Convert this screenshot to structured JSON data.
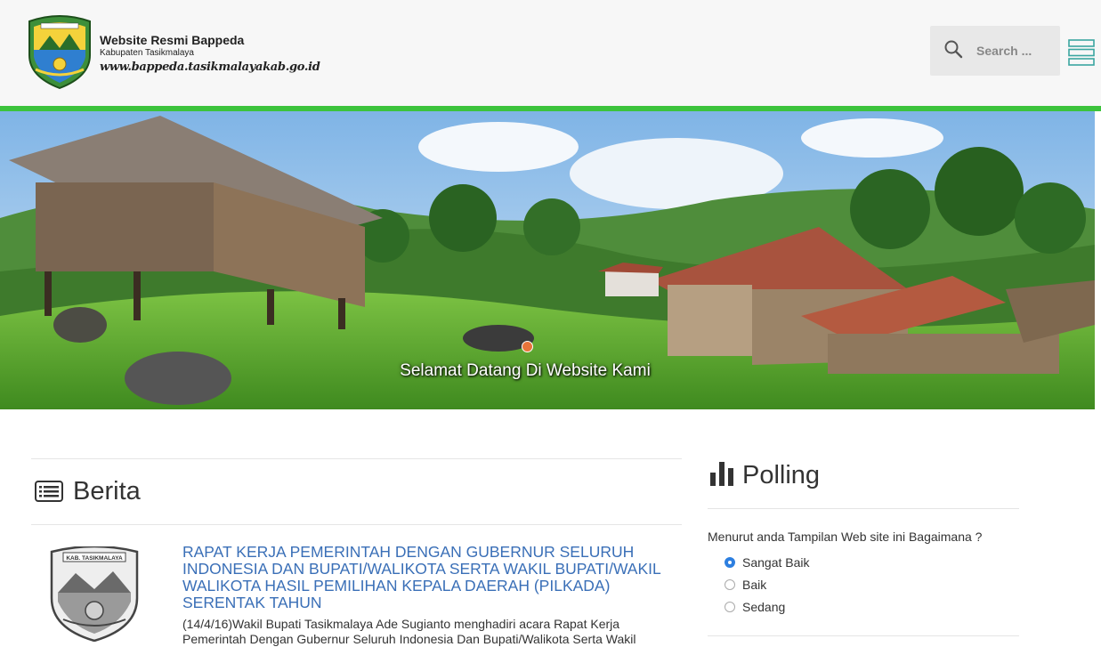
{
  "header": {
    "site_title": "Website Resmi Bappeda",
    "site_subtitle": "Kabupaten Tasikmalaya",
    "site_url": "www.bappeda.tasikmalayakab.go.id",
    "logo_label": "KAB. TASIKMALAYA",
    "search_placeholder": "Search ...",
    "search_icon": "search-icon",
    "menu_icon": "hamburger-menu-icon",
    "accent_color": "#3cc33c"
  },
  "hero": {
    "caption": "Selamat Datang Di Website Kami",
    "indicator_color": "#e8743a"
  },
  "berita": {
    "heading": "Berita",
    "icon": "list-icon",
    "items": [
      {
        "thumb_label": "KAB. TASIKMALAYA",
        "title": "RAPAT KERJA PEMERINTAH DENGAN GUBERNUR SELURUH INDONESIA DAN BUPATI/WALIKOTA SERTA WAKIL BUPATI/WAKIL WALIKOTA HASIL PEMILIHAN KEPALA DAERAH (PILKADA) SERENTAK TAHUN",
        "excerpt": "(14/4/16)Wakil Bupati Tasikmalaya Ade Sugianto menghadiri acara Rapat Kerja Pemerintah Dengan Gubernur Seluruh Indonesia Dan Bupati/Walikota Serta Wakil"
      }
    ]
  },
  "polling": {
    "heading": "Polling",
    "icon": "bar-chart-icon",
    "question": "Menurut anda Tampilan Web site ini Bagaimana ?",
    "options": [
      {
        "label": "Sangat Baik",
        "selected": true
      },
      {
        "label": "Baik",
        "selected": false
      },
      {
        "label": "Sedang",
        "selected": false
      }
    ]
  }
}
